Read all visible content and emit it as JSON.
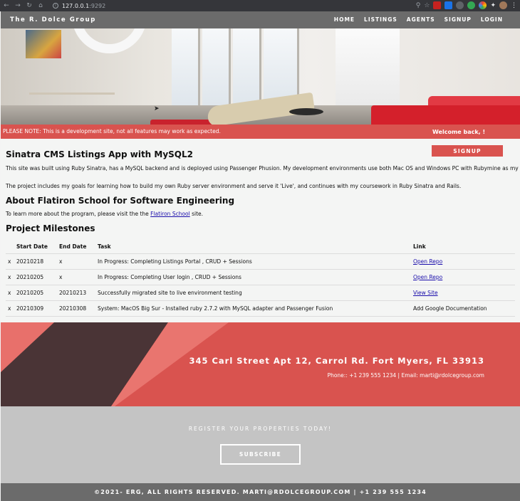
{
  "browser": {
    "url_host": "127.0.0.1",
    "url_port": ":9292"
  },
  "nav": {
    "brand": "The R. Dolce Group",
    "links": [
      "HOME",
      "LISTINGS",
      "AGENTS",
      "SIGNUP",
      "LOGIN"
    ]
  },
  "notice": {
    "message": "PLEASE NOTE: This is a development site, not all features may work as expected.",
    "welcome": "Welcome back, !"
  },
  "content": {
    "signup_button": "SIGNUP",
    "title1": "Sinatra CMS Listings App with MySQL2",
    "para1": "This site was built using Ruby Sinatra, has a MySQL backend and is deployed using Passenger Phusion. My development environments use both Mac OS and Windows PC with Rubymine as my IDE.",
    "para2": "The project includes my goals for learning how to build my own Ruby server environment and serve it 'Live', and continues with my coursework in Ruby Sinatra and Rails.",
    "title2": "About Flatiron School for Software Engineering",
    "para3_before": "To learn more about the program, please visit the the ",
    "para3_link": "Flatiron School",
    "para3_after": " site.",
    "title3": "Project Milestones",
    "table_headers": [
      "Start Date",
      "End Date",
      "Task",
      "Link"
    ],
    "rows": [
      {
        "mark": "x",
        "start": "20210218",
        "end": "x",
        "task": "In Progress: Completing Listings Portal , CRUD + Sessions",
        "link": "Open Repo",
        "is_link": true
      },
      {
        "mark": "x",
        "start": "20210205",
        "end": "x",
        "task": "In Progress: Completing User login , CRUD + Sessions",
        "link": "Open Repo",
        "is_link": true
      },
      {
        "mark": "x",
        "start": "20210205",
        "end": "20210213",
        "task": "Successfully migrated site to live environment testing",
        "link": "View Site",
        "is_link": true
      },
      {
        "mark": "x",
        "start": "20210309",
        "end": "20210308",
        "task": "System: MacOS Big Sur - Installed ruby 2.7.2 with MySQL adapter and Passenger Fusion",
        "link": "Add Google Documentation",
        "is_link": false
      }
    ]
  },
  "footer": {
    "address": "345 Carl Street Apt 12, Carrol Rd. Fort Myers, FL 33913",
    "contact": "Phone:: +1 239 555 1234 | Email: marti@rdolcegroup.com",
    "register_title": "REGISTER YOUR PROPERTIES TODAY!",
    "subscribe": "SUBSCRIBE",
    "copyright": "©2021- ERG, ALL RIGHTS RESERVED. MARTI@RDOLCEGROUP.COM | +1 239 555 1234"
  },
  "colors": {
    "accent": "#d9534f",
    "nav": "#6b6b6b",
    "register_bg": "#c4c4c4"
  }
}
